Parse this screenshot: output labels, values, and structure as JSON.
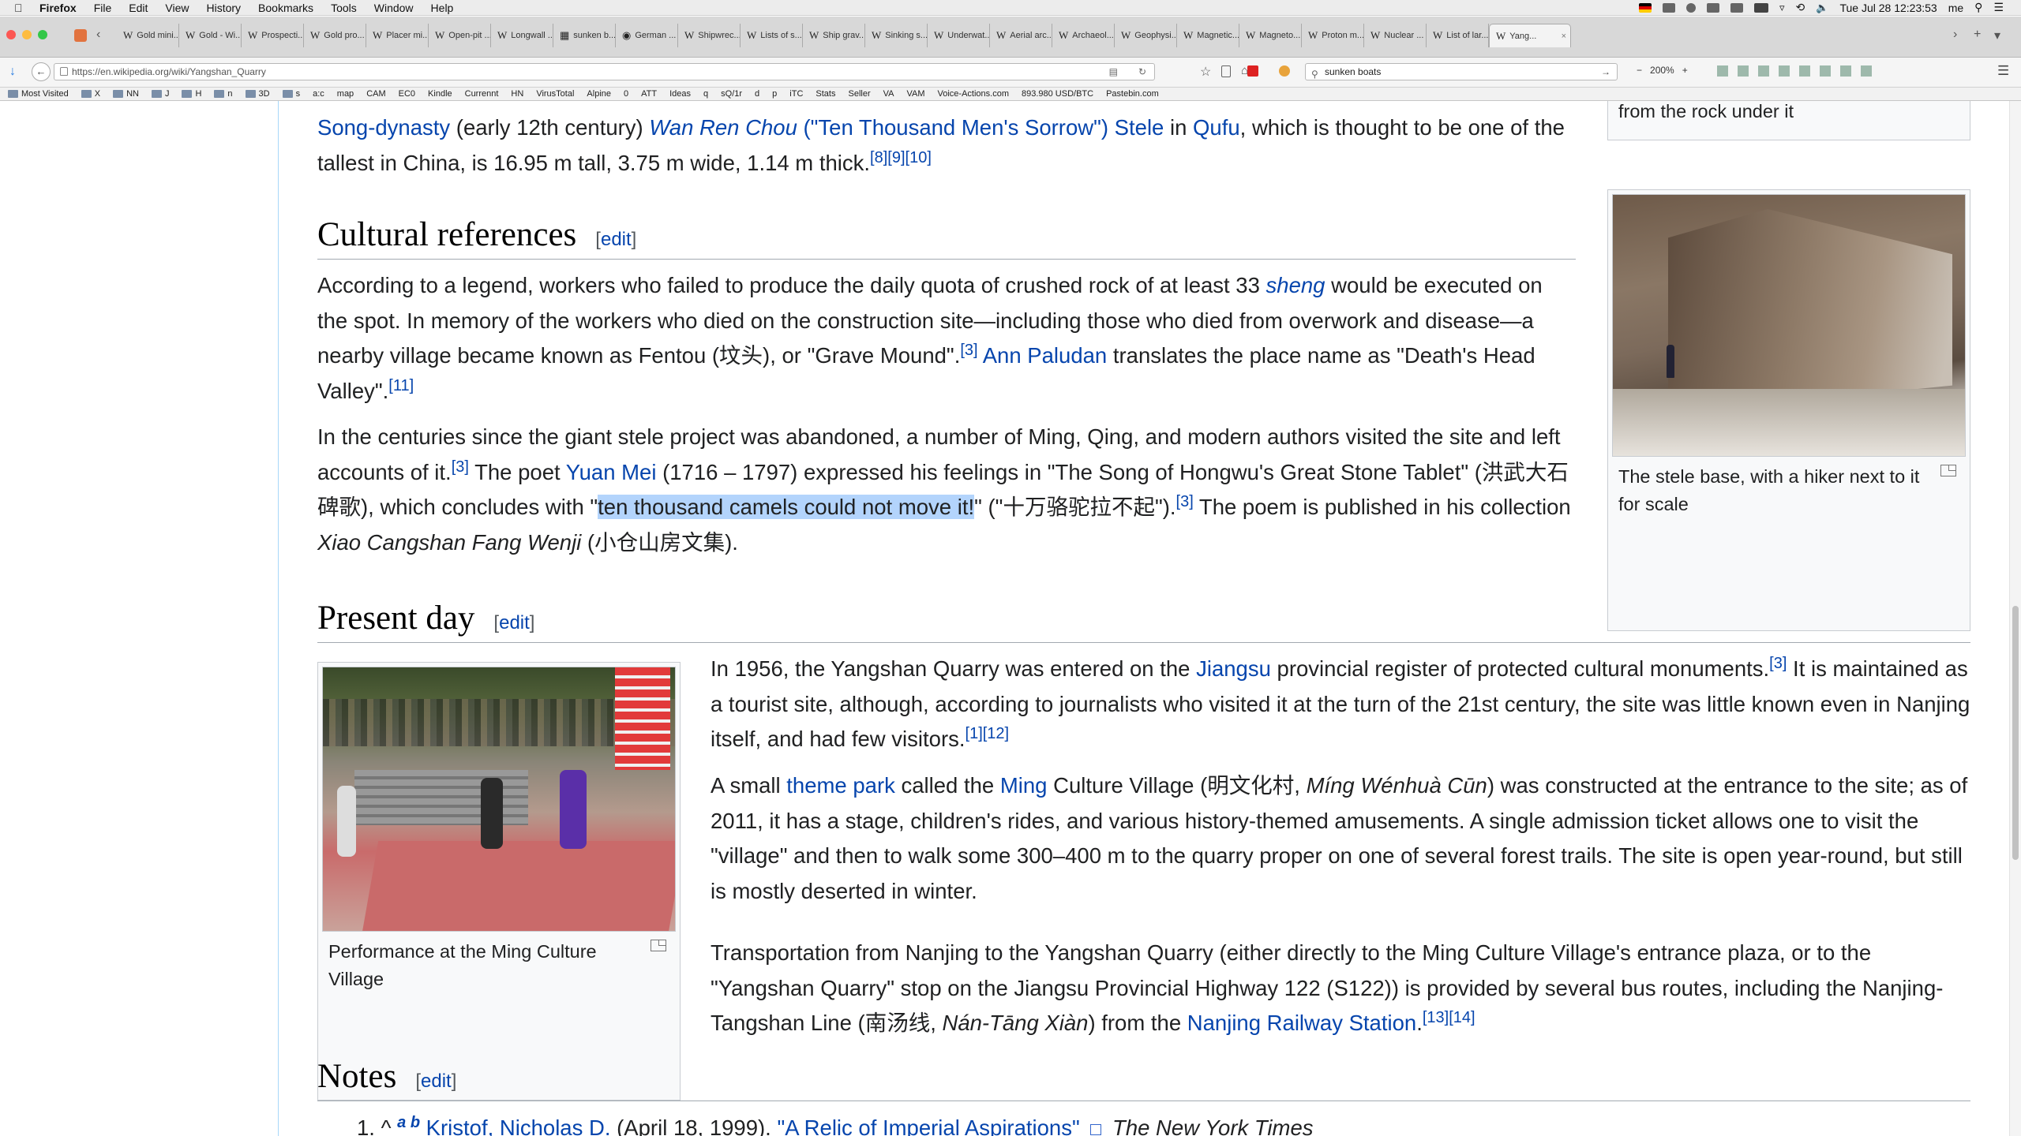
{
  "mac": {
    "menus": [
      "Firefox",
      "File",
      "Edit",
      "View",
      "History",
      "Bookmarks",
      "Tools",
      "Window",
      "Help"
    ],
    "clock": "Tue Jul 28  12:23:53",
    "user": "me"
  },
  "tabs": [
    "Gold mini...",
    "Gold - Wi...",
    "Prospecti...",
    "Gold pro...",
    "Placer mi...",
    "Open-pit ...",
    "Longwall ...",
    "sunken b...",
    "German ...",
    "Shipwrec...",
    "Lists of s...",
    "Ship grav...",
    "Sinking s...",
    "Underwat...",
    "Aerial arc...",
    "Archaeol...",
    "Geophysi...",
    "Magnetic...",
    "Magneto...",
    "Proton m...",
    "Nuclear ...",
    "List of lar...",
    "Yang..."
  ],
  "nav": {
    "url": "https://en.wikipedia.org/wiki/Yangshan_Quarry",
    "search_value": "sunken boats",
    "zoom": "200%"
  },
  "bookmarks": [
    "Most Visited",
    "X",
    "NN",
    "J",
    "H",
    "n",
    "3D",
    "s",
    "a:c",
    "map",
    "CAM",
    "EC0",
    "Kindle",
    "Currennt",
    "HN",
    "VirusTotal",
    "Alpine",
    "0",
    "ATT",
    "Ideas",
    "q",
    "sQ/1r",
    "d",
    "p",
    "iTC",
    "Stats",
    "Seller",
    "VA",
    "VAM",
    "Voice-Actions.com",
    "893.980 USD/BTC",
    "Pastebin.com"
  ],
  "article": {
    "top_para": {
      "a1": "Song-dynasty",
      "t1": " (early 12th century) ",
      "a2": "Wan Ren Chou",
      "a3": " (\"Ten Thousand Men's Sorrow\") Stele",
      "t2": " in ",
      "a4": "Qufu",
      "t3": ", which is thought to be one of the tallest in China, is 16.95 m tall, 3.75 m wide, 1.14 m thick.",
      "refs": "[8][9][10]"
    },
    "cultural": {
      "heading": "Cultural references",
      "edit": "edit",
      "p1_t1": "According to a legend, workers who failed to produce the daily quota of crushed rock of at least 33 ",
      "p1_a1": "sheng",
      "p1_t2": " would be executed on the spot. In memory of the workers who died on the construction site—including those who died from overwork and disease—a nearby village became known as Fentou (坟头), or \"Grave Mound\".",
      "p1_ref1": "[3]",
      "p1_a2": " Ann Paludan",
      "p1_t3": " translates the place name as \"Death's Head Valley\".",
      "p1_ref2": "[11]",
      "p2_t1": "In the centuries since the giant stele project was abandoned, a number of Ming, Qing, and modern authors visited the site and left accounts of it.",
      "p2_ref1": "[3]",
      "p2_t2": " The poet ",
      "p2_a1": "Yuan Mei",
      "p2_t3": " (1716 – 1797) expressed his feelings in \"The Song of Hongwu's Great Stone Tablet\" (洪武大石碑歌), which concludes with \"",
      "p2_hl": "ten thousand camels could not move it!",
      "p2_t4": "\" (\"十万骆驼拉不起\").",
      "p2_ref2": "[3]",
      "p2_t5": " The poem is published in his collection ",
      "p2_i1": "Xiao Cangshan Fang Wenji",
      "p2_t6": " (小仓山房文集)."
    },
    "present": {
      "heading": "Present day",
      "edit": "edit",
      "p1_t1": "In 1956, the Yangshan Quarry was entered on the ",
      "p1_a1": "Jiangsu",
      "p1_t2": " provincial register of protected cultural monuments.",
      "p1_ref1": "[3]",
      "p1_t3": " It is maintained as a tourist site, although, according to journalists who visited it at the turn of the 21st century, the site was little known even in Nanjing itself, and had few visitors.",
      "p1_ref2": "[1][12]",
      "p2_t1": "A small ",
      "p2_a1": "theme park",
      "p2_t2": " called the ",
      "p2_a2": "Ming",
      "p2_t3": " Culture Village (明文化村, ",
      "p2_i1": "Míng Wénhuà Cūn",
      "p2_t4": ") was constructed at the entrance to the site; as of 2011, it has a stage, children's rides, and various history-themed amusements. A single admission ticket allows one to visit the \"village\" and then to walk some 300–400 m to the quarry proper on one of several forest trails. The site is open year-round, but still is mostly deserted in winter.",
      "p3_t1": "Transportation from Nanjing to the Yangshan Quarry (either directly to the Ming Culture Village's entrance plaza, or to the \"Yangshan Quarry\" stop on the Jiangsu Provincial Highway 122 (S122)) is provided by several bus routes, including the Nanjing-Tangshan Line (南汤线, ",
      "p3_i1": "Nán-Tāng Xiàn",
      "p3_t2": ") from the ",
      "p3_a1": "Nanjing Railway Station",
      "p3_t3": ".",
      "p3_ref1": "[13][14]"
    },
    "notes": {
      "heading": "Notes",
      "edit": "edit",
      "n1_num": "1.",
      "n1_caret": "^",
      "n1_a": "a",
      "n1_b": "b",
      "n1_author": "Kristof, Nicholas D.",
      "n1_date": " (April 18, 1999). ",
      "n1_title": "\"A Relic of Imperial Aspirations\"",
      "n1_pub": "The New York Times"
    },
    "fig_top_caption_tail": "Under the stele body, mostly separated from the rock under it",
    "fig_base_caption": "The stele base, with a hiker next to it for scale",
    "fig_perf_caption": "Performance at the Ming Culture Village"
  }
}
